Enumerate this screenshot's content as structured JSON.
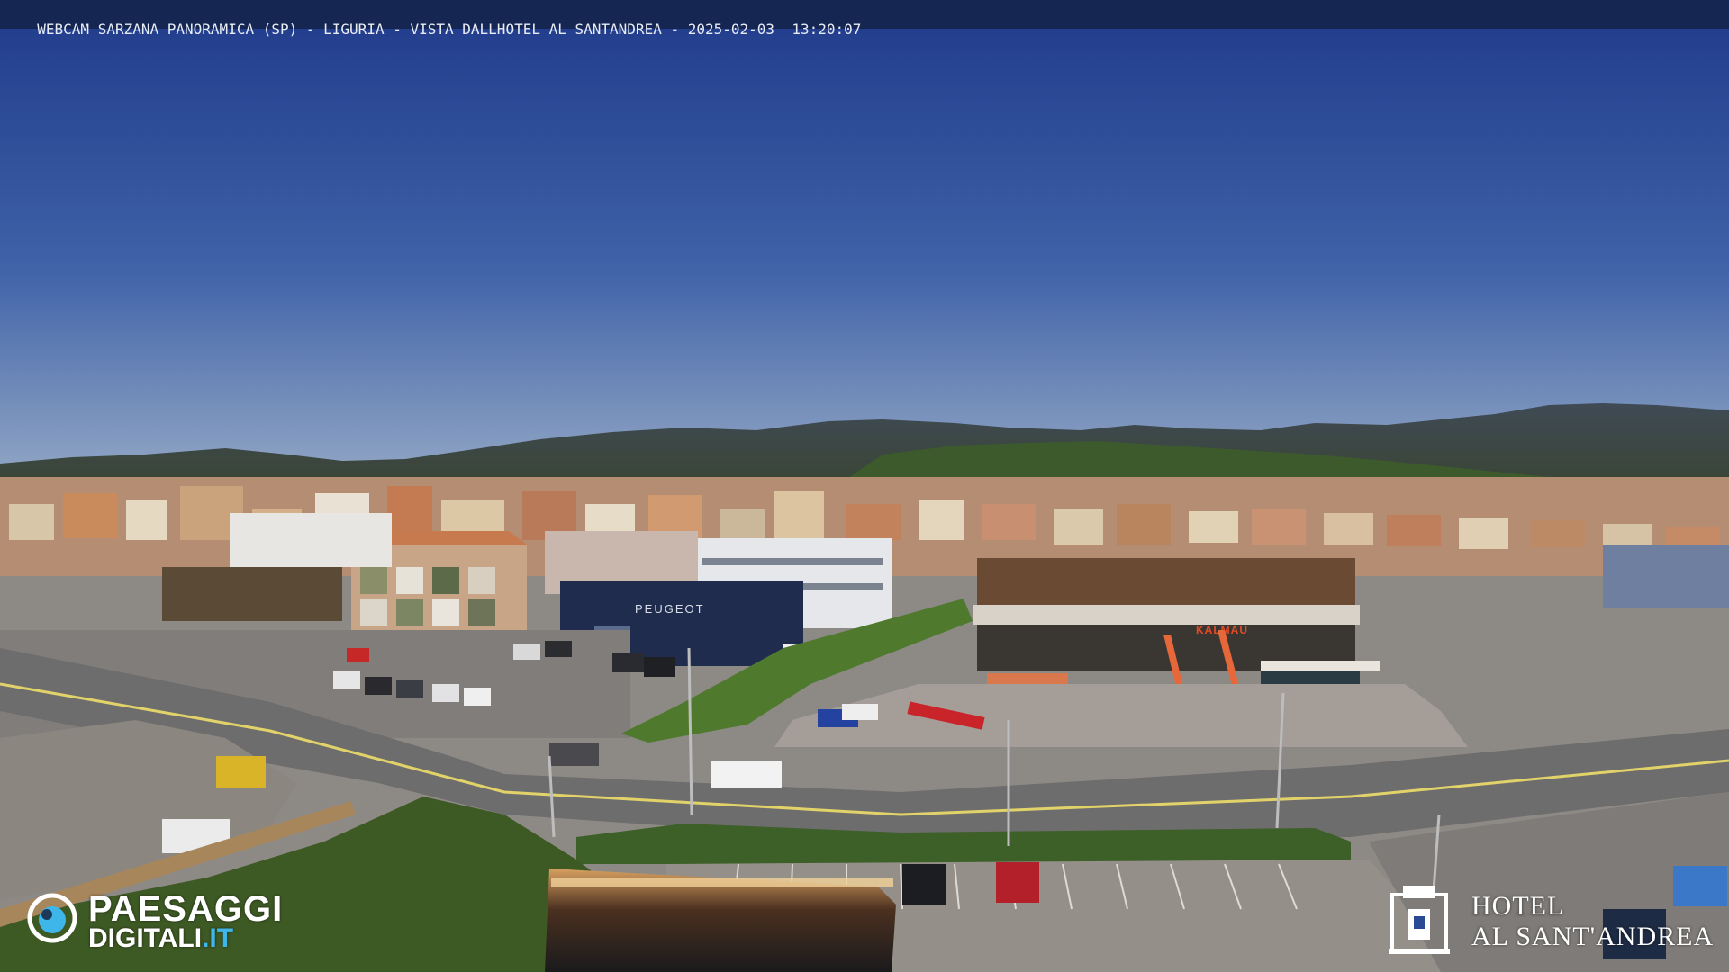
{
  "overlay": {
    "title": "WEBCAM SARZANA PANORAMICA (SP) - LIGURIA - VISTA DALLHOTEL AL SANTANDREA - 2025-02-03  13:20:07"
  },
  "logo_left": {
    "line1": "PAESAGGI",
    "line2_main": "DIGITALI",
    "line2_tld": ".IT",
    "icon": "eye-icon"
  },
  "logo_right": {
    "line1": "HOTEL",
    "line2": "AL SANT'ANDREA",
    "icon": "hotel-crest-icon"
  },
  "signs": {
    "dealer": "PEUGEOT",
    "shop": "KALMAU"
  },
  "colors": {
    "sky_top": "#1e3c8c",
    "sky_bottom": "#8fa6c6",
    "mountains": "#3a4a4c",
    "road": "#6e6d6d",
    "grass": "#4f7a2e",
    "logo_accent": "#3fb6ea"
  }
}
